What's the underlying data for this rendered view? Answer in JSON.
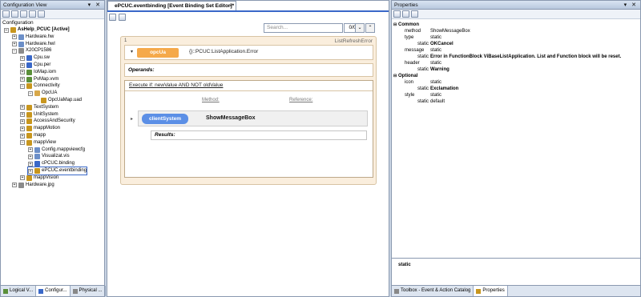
{
  "left_pane": {
    "title": "Configuration View",
    "config_label": "Configuration",
    "tree": [
      {
        "label": "AsHelp_PCUC [Active]",
        "bold": true
      },
      {
        "label": "Hardware.hw"
      },
      {
        "label": "Hardware.hwl"
      },
      {
        "label": "X20CP1586"
      },
      {
        "label": "Cpu.sw"
      },
      {
        "label": "Cpu.per"
      },
      {
        "label": "IoMap.iom"
      },
      {
        "label": "PvMap.vvm"
      },
      {
        "label": "Connectivity"
      },
      {
        "label": "OpcUA"
      },
      {
        "label": "OpcUaMap.uad"
      },
      {
        "label": "TextSystem"
      },
      {
        "label": "UnitSystem"
      },
      {
        "label": "AccessAndSecurity"
      },
      {
        "label": "mappMotion"
      },
      {
        "label": "mapp"
      },
      {
        "label": "mappView"
      },
      {
        "label": "Config.mappviewcfg"
      },
      {
        "label": "Visualizat.vis"
      },
      {
        "label": "cPCUC.binding"
      },
      {
        "label": "ePCUC.eventbinding"
      },
      {
        "label": "mappVision"
      },
      {
        "label": "Hardware.jpg"
      }
    ],
    "bottom_tabs": [
      "Logical V...",
      "Configur...",
      "Physical ..."
    ]
  },
  "editor": {
    "tab_title": "ePCUC.eventbinding [Event Binding Set Editor]*",
    "tab_close": "×",
    "search_placeholder": "Search...",
    "search_count": "0/0",
    "nav_down": "⌄",
    "nav_up": "⌃",
    "event_number": "1",
    "event_name": "ListRefreshError",
    "collapse_glyph": "▾",
    "source_pill": "opcUa",
    "source_expression": "{}::PCUC:ListApplication.Error",
    "operands_label": "Operands:",
    "condition": "Execute if: newValue AND NOT oldValue",
    "method_header": "Method:",
    "reference_header": "Reference:",
    "bullet": "▸",
    "target_pill": "clientSystem",
    "method_name": "ShowMessageBox",
    "results_label": "Results:"
  },
  "right_pane": {
    "title": "Properties",
    "rows": [
      {
        "kind": "cat",
        "key": "Common",
        "exp": "⊟"
      },
      {
        "kind": "kv",
        "key": "method",
        "value": "ShowMessageBox"
      },
      {
        "kind": "kv",
        "key": "type",
        "value": "static"
      },
      {
        "kind": "val",
        "key": "static",
        "value": "OKCancel",
        "bold": true
      },
      {
        "kind": "kv",
        "key": "message",
        "value": "static"
      },
      {
        "kind": "val",
        "key": "static",
        "value": "Error in FunctionBlock ViBaseListApplication. List and Function block will be reset.",
        "bold": true
      },
      {
        "kind": "kv",
        "key": "header",
        "value": "static"
      },
      {
        "kind": "val",
        "key": "static",
        "value": "Warning",
        "bold": true
      },
      {
        "kind": "cat",
        "key": "Optional",
        "exp": "⊟"
      },
      {
        "kind": "kv",
        "key": "icon",
        "value": "static"
      },
      {
        "kind": "val",
        "key": "static",
        "value": "Exclamation",
        "bold": true
      },
      {
        "kind": "kv",
        "key": "style",
        "value": "static"
      },
      {
        "kind": "val",
        "key": "static",
        "value": "default",
        "bold": false
      }
    ],
    "description": "static",
    "bottom_tabs": [
      "Toolbox - Event & Action Catalog",
      "Properties"
    ]
  }
}
